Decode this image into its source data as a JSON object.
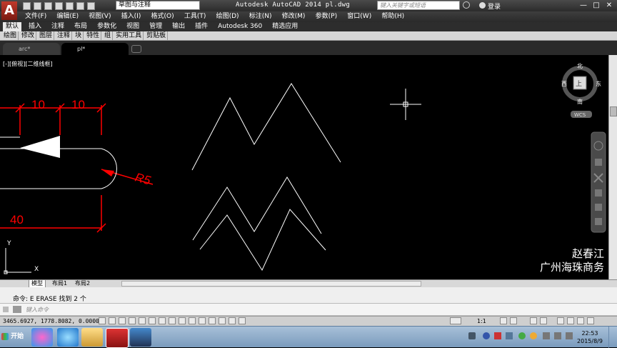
{
  "titlebar": {
    "workspace": "草图与注释",
    "app_title": "Autodesk AutoCAD 2014    pl.dwg",
    "search_placeholder": "键入关键字或短语",
    "login": "登录",
    "min": "—",
    "max": "□",
    "close": "✕"
  },
  "logo": {
    "glyph": "A"
  },
  "menu": [
    "文件(F)",
    "编辑(E)",
    "视图(V)",
    "插入(I)",
    "格式(O)",
    "工具(T)",
    "绘图(D)",
    "标注(N)",
    "修改(M)",
    "参数(P)",
    "窗口(W)",
    "帮助(H)"
  ],
  "ribbon_tabs": [
    "默认",
    "插入",
    "注释",
    "布局",
    "参数化",
    "视图",
    "管理",
    "输出",
    "插件",
    "Autodesk 360",
    "精选应用"
  ],
  "ribbon_panels": [
    "绘图",
    "修改",
    "图层",
    "注释",
    "块",
    "特性",
    "组",
    "实用工具",
    "剪贴板"
  ],
  "doc_tabs": [
    "arc*",
    "pl*"
  ],
  "viewport_label": "[-][俯视][二维线框]",
  "viewcube": {
    "north": "北",
    "south": "南",
    "east": "东",
    "west": "西",
    "top": "上",
    "wcs": "WCS"
  },
  "dimensions": {
    "d1": "10",
    "d2": "10",
    "radius": "R5",
    "d3": "40"
  },
  "ucs": {
    "y": "Y",
    "x": "X"
  },
  "watermark": {
    "line1": "赵春江",
    "line2": "广州海珠商务"
  },
  "layout_tabs": [
    "模型",
    "布局1",
    "布局2"
  ],
  "command": {
    "history": "命令: E ERASE 找到 2 个",
    "placeholder": "键入命令"
  },
  "status": {
    "coords": "3465.6927, 1778.8082, 0.0000",
    "scale": "1:1"
  },
  "taskbar": {
    "start": "开始",
    "time": "22:53",
    "date": "2015/8/9"
  },
  "colors": {
    "dimension": "#ff0000",
    "geometry": "#ffffff",
    "background": "#000000"
  }
}
